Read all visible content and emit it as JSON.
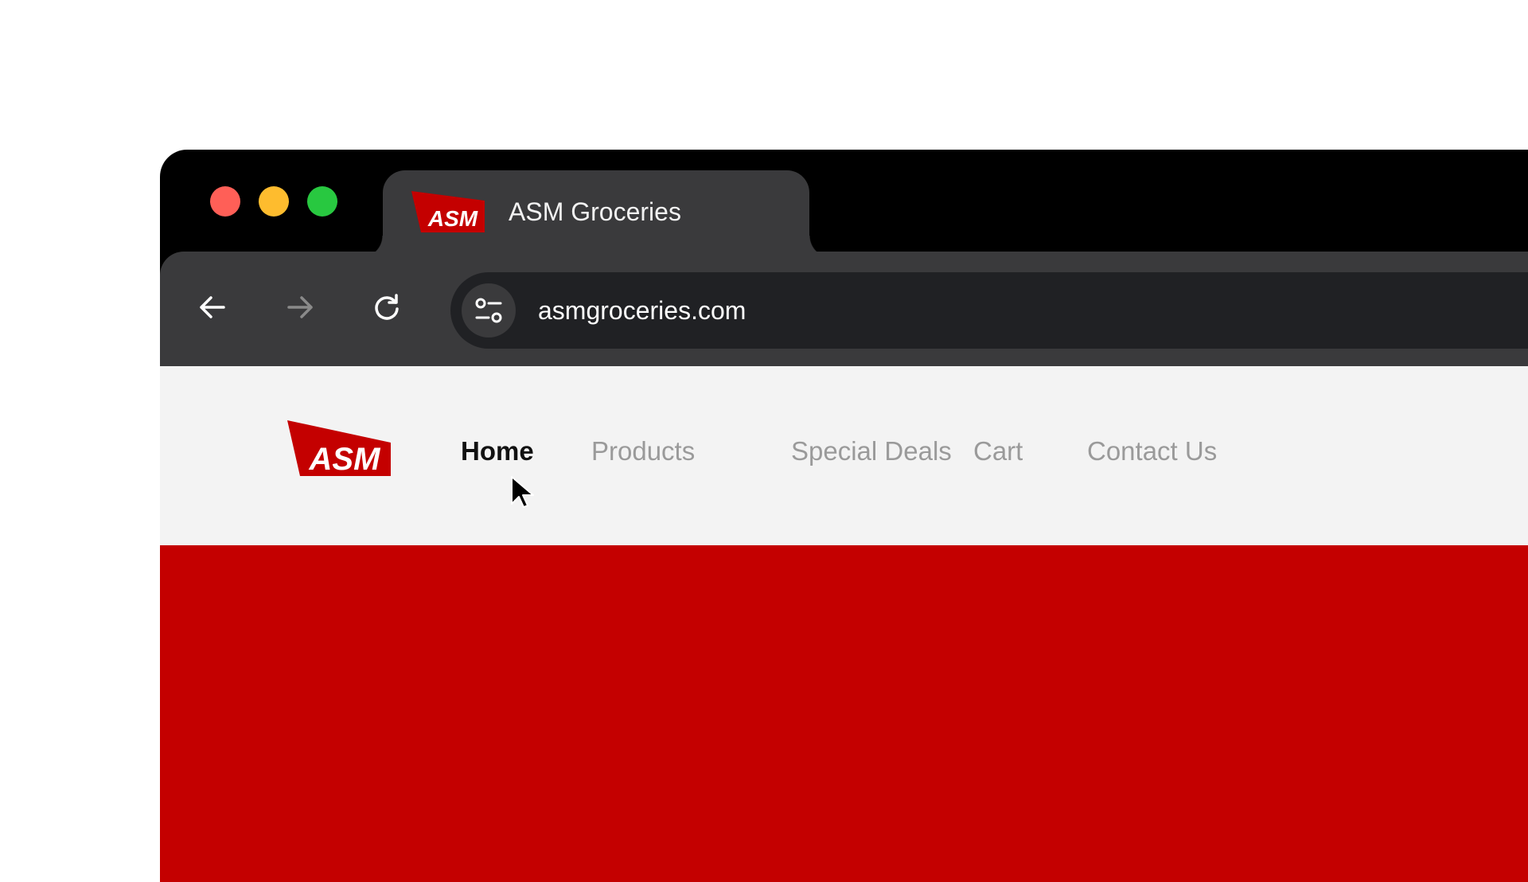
{
  "window": {
    "traffic_lights": [
      "close",
      "minimize",
      "maximize"
    ],
    "colors": {
      "close": "#ff5f57",
      "minimize": "#febc2e",
      "maximize": "#28c840"
    }
  },
  "tab": {
    "logo_text": "ASM",
    "title": "ASM Groceries"
  },
  "toolbar": {
    "back_icon": "arrow-left-icon",
    "forward_icon": "arrow-right-icon",
    "reload_icon": "reload-icon",
    "site_info_icon": "tune-icon",
    "url": "asmgroceries.com"
  },
  "site": {
    "logo_text": "ASM",
    "brand_color": "#c40000",
    "nav": [
      {
        "label": "Home",
        "active": true
      },
      {
        "label": "Products",
        "active": false
      },
      {
        "label": "Special Deals",
        "active": false
      },
      {
        "label": "Cart",
        "active": false
      },
      {
        "label": "Contact Us",
        "active": false
      }
    ]
  }
}
